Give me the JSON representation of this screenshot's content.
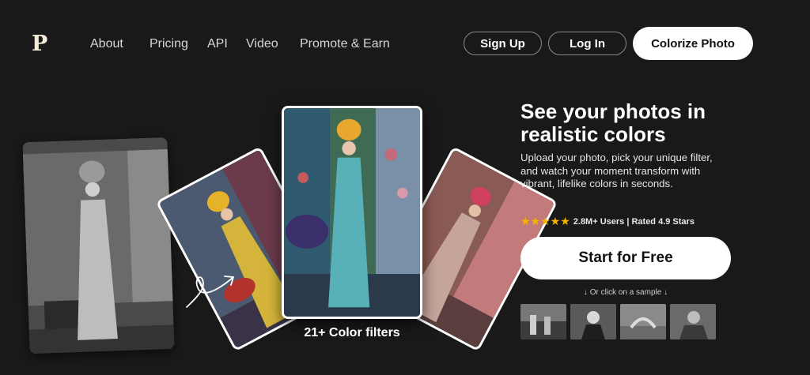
{
  "brand": {
    "logo": "P"
  },
  "nav": {
    "items": [
      "About",
      "Pricing",
      "API",
      "Video",
      "Promote & Earn"
    ]
  },
  "auth": {
    "signup": "Sign Up",
    "login": "Log In",
    "colorize": "Colorize Photo"
  },
  "hero": {
    "headline": "See your photos in realistic colors",
    "description": "Upload your photo, pick your unique filter, and watch your moment transform with vibrant, lifelike colors in seconds.",
    "stars": "★★★★★",
    "rating_text": "2.8M+ Users | Rated 4.9 Stars",
    "cta": "Start for Free",
    "sample_hint": "↓ Or click on a sample ↓",
    "filters_caption": "21+ Color filters"
  },
  "colors": {
    "background": "#19191a",
    "accent_star": "#f5b400",
    "button": "#ffffff"
  }
}
